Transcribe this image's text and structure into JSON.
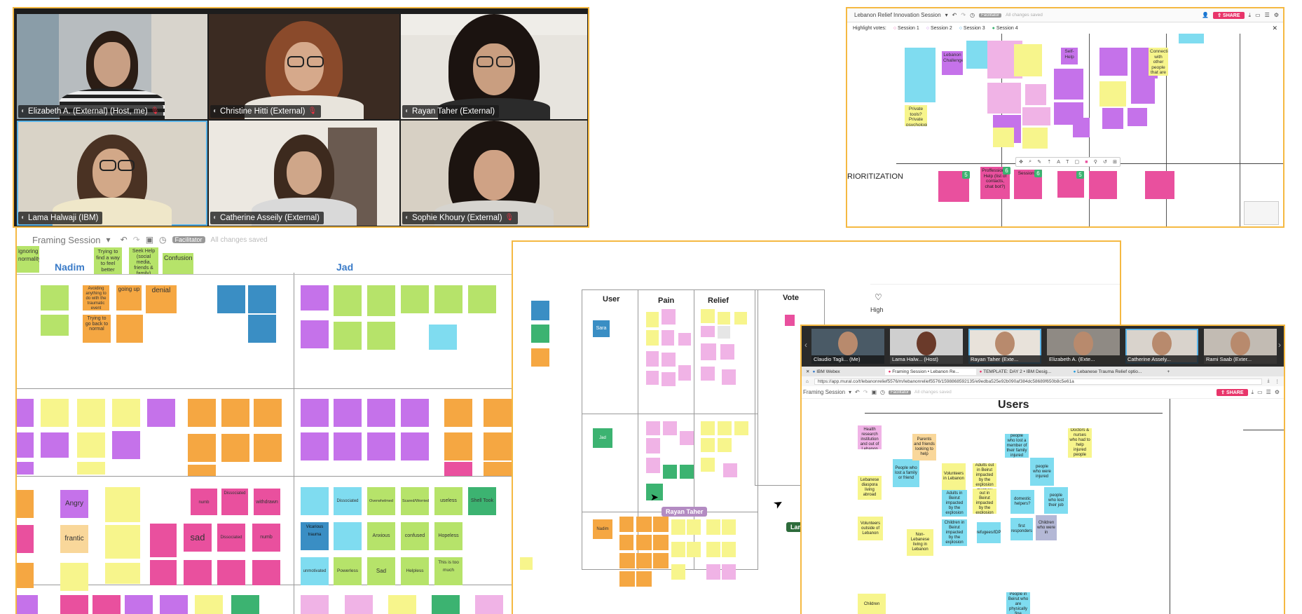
{
  "video": {
    "participants": [
      {
        "name": "Elizabeth A. (External) (Host, me)"
      },
      {
        "name": "Christine Hitti (External)"
      },
      {
        "name": "Rayan Taher (External)"
      },
      {
        "name": "Lama Halwaji (IBM)"
      },
      {
        "name": "Catherine Asseily (External)"
      },
      {
        "name": "Sophie Khoury (External)"
      }
    ]
  },
  "topright": {
    "title": "Lebanon Relief Innovation Session",
    "facilitator": "Facilitator",
    "saved": "All changes saved",
    "share": "SHARE",
    "highlight_label": "Highlight votes:",
    "sessions": [
      "Session 1",
      "Session 2",
      "Session 3",
      "Session 4"
    ],
    "prioritization": "RIORITIZATION",
    "vote_counts": [
      "5",
      "6",
      "6",
      "5"
    ],
    "notes": [
      "Proffessional Help (list of contacts, chat bot?)",
      "Self-Help",
      "Session 4",
      "Private tools? Private psychologist",
      "Lebanon Challenge",
      "Connection with other people that are volunteering"
    ]
  },
  "framing": {
    "title": "Framing Session",
    "facilitator": "Facilitator",
    "saved": "All changes saved",
    "col1": "Nadim",
    "col2": "Jad",
    "top_notes": [
      "ignoring normality",
      "Trying to find a way to feel better",
      "Seek Help (social media, friends & family)",
      "Confusion"
    ],
    "notes_orange": [
      "denial",
      "going up",
      "Avoiding anything to do with the traumatic event",
      "Trying to go back to normal"
    ],
    "notes_big": [
      "Angry",
      "frantic",
      "sad",
      "Dissociated",
      "numb",
      "withdrawn",
      "Anxious",
      "Hopeless",
      "Powerless",
      "Sad",
      "Helpless",
      "useless",
      "Shell Took",
      "Dissociated",
      "Overwhelmed",
      "Scared/Worried",
      "Anxious",
      "confused",
      "Hopeless",
      "This is too much",
      "unmotivated",
      "Vicarious trauma"
    ]
  },
  "canvas": {
    "headers": [
      "User",
      "Pain",
      "Relief",
      "Vote"
    ],
    "users": [
      "Sara",
      "Jad",
      "Nadim"
    ],
    "cursor_name": "Rayan Taher",
    "high": "High",
    "cursor2": "Lam"
  },
  "br": {
    "participants": [
      "Claudio Tagli... (Me)",
      "Lama Halw... (Host)",
      "Rayan Taher (Exte...",
      "Elizabeth A. (Exte...",
      "Catherine Assely...",
      "Rami Saab (Exter..."
    ],
    "tabs": [
      "IBM Webex",
      "Framing Session • Lebanon Re...",
      "TEMPLATE: DAY 2 • IBM Desig...",
      "Lebanese Trauma Relief optio..."
    ],
    "url": "https://app.mural.co/t/lebanonrelief5576/m/lebanonrelief5576/1598868592135/e9edba525e92b090af384dc58689f650b8c5e61a",
    "title": "Framing Session",
    "facilitator": "Facilitator",
    "saved": "All changes saved",
    "share": "SHARE",
    "users_header": "Users",
    "notes": [
      {
        "t": "Lebanese diaspora living abroad",
        "c": "#f7f58c"
      },
      {
        "t": "People who lost a family or friend",
        "c": "#7fdcf0"
      },
      {
        "t": "Volunteers in Lebanon",
        "c": "#f7f58c"
      },
      {
        "t": "Adults out in Beirut impacted by the explosion",
        "c": "#f7f58c"
      },
      {
        "t": "people who were injured",
        "c": "#7fdcf0"
      },
      {
        "t": "Doctors & nurses who had to help injured people",
        "c": "#f7f58c"
      },
      {
        "t": "Volunteers outside of Lebanon",
        "c": "#f7f58c"
      },
      {
        "t": "Adults in Beirut impacted by the explosion",
        "c": "#7fdcf0"
      },
      {
        "t": "Children out in Beirut impacted by the explosion",
        "c": "#f7f58c"
      },
      {
        "t": "domestic helpers?",
        "c": "#7fdcf0"
      },
      {
        "t": "people who lost their job",
        "c": "#7fdcf0"
      },
      {
        "t": "Children in Beirut impacted by the explosion",
        "c": "#7fdcf0"
      },
      {
        "t": "refugees/IDP",
        "c": "#7fdcf0"
      },
      {
        "t": "first responders",
        "c": "#7fdcf0"
      },
      {
        "t": "Children who were in",
        "c": "#b4b8d6"
      },
      {
        "t": "Non-Lebanese living in Lebanon",
        "c": "#f7f58c"
      },
      {
        "t": "Parents and friends looking to help",
        "c": "#f9d79a"
      },
      {
        "t": "people who lost a member of their family injured",
        "c": "#7fdcf0"
      },
      {
        "t": "Mental Health research institution and out of Lebanon",
        "c": "#f0b3e6"
      },
      {
        "t": "Children",
        "c": "#f7f58c"
      },
      {
        "t": "People in Beirut who are physically fine",
        "c": "#7fdcf0"
      }
    ]
  },
  "colors": {
    "panel_border": "#f5b942",
    "share": "#e8356a",
    "sticky_yellow": "#f7f58c",
    "sticky_pink": "#e9509e",
    "sticky_purple": "#c572ea",
    "sticky_blue": "#7fdcf0",
    "sticky_green": "#b6e36a",
    "sticky_orange": "#f5a742"
  }
}
